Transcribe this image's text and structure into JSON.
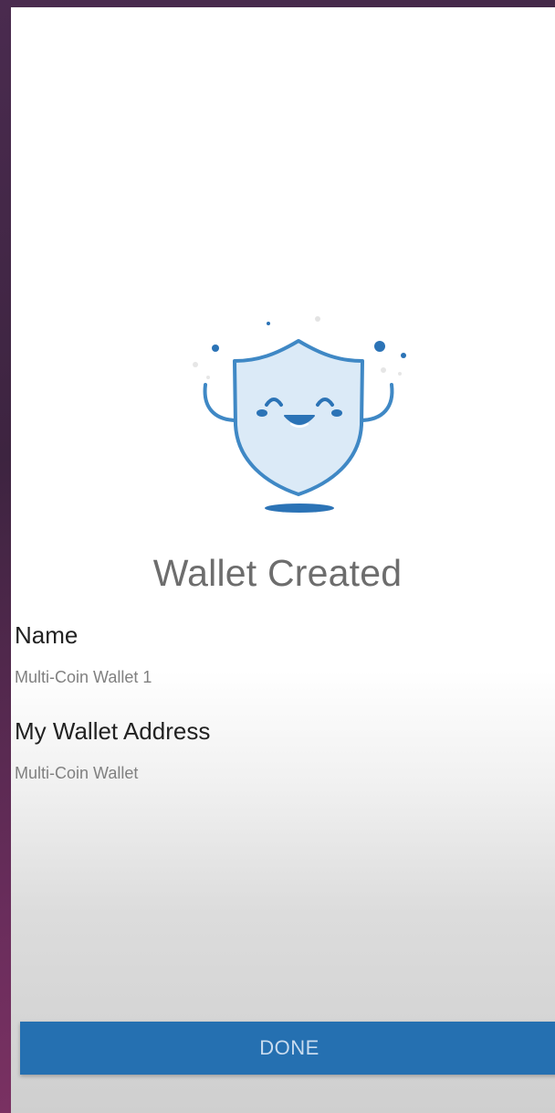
{
  "screen": {
    "title": "Wallet Created",
    "name_label": "Name",
    "name_value": "Multi-Coin Wallet 1",
    "address_label": "My Wallet Address",
    "address_value": "Multi-Coin Wallet"
  },
  "actions": {
    "done_label": "DONE"
  },
  "icons": {
    "illustration": "happy-shield-icon"
  },
  "colors": {
    "accent": "#2570b1",
    "shield_fill": "#dbeaf7",
    "shield_stroke": "#3f88c5"
  }
}
